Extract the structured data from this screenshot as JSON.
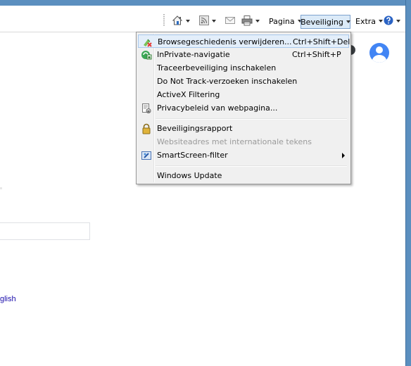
{
  "toolbar": {
    "page_label": "Pagina",
    "security_label": "Beveiliging",
    "extra_label": "Extra"
  },
  "menu": {
    "items": [
      {
        "label": "Browsegeschiedenis verwijderen...",
        "shortcut": "Ctrl+Shift+Del",
        "icon": "delete-history-icon",
        "highlighted": true
      },
      {
        "label": "InPrivate-navigatie",
        "shortcut": "Ctrl+Shift+P",
        "icon": "inprivate-icon"
      },
      {
        "label": "Traceerbeveiliging inschakelen",
        "shortcut": ""
      },
      {
        "label": "Do Not Track-verzoeken inschakelen",
        "shortcut": ""
      },
      {
        "label": "ActiveX Filtering",
        "shortcut": ""
      },
      {
        "label": "Privacybeleid van webpagina...",
        "shortcut": "",
        "icon": "privacy-policy-icon"
      },
      {
        "label": "Beveiligingsrapport",
        "shortcut": "",
        "icon": "lock-icon"
      },
      {
        "label": "Websiteadres met internationale tekens",
        "shortcut": "",
        "disabled": true
      },
      {
        "label": "SmartScreen-filter",
        "shortcut": "",
        "icon": "smartscreen-icon",
        "submenu": true
      },
      {
        "label": "Windows Update",
        "shortcut": ""
      }
    ]
  },
  "page": {
    "language_link": "glish"
  }
}
